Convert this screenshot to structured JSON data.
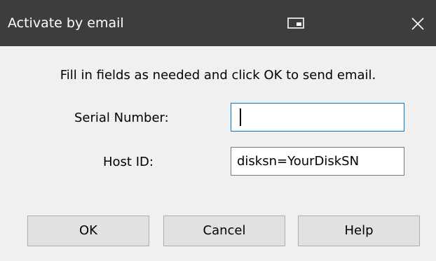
{
  "window": {
    "title": "Activate by email",
    "icons": {
      "snap": "snap-layout-icon",
      "close": "close-icon"
    },
    "colors": {
      "titlebar": "#3d3d3d",
      "body": "#f0f0f0",
      "focus_border": "#0078d7"
    }
  },
  "form": {
    "instructions": "Fill in fields as needed and click OK to send email.",
    "serial_label": "Serial Number:",
    "serial_value": "",
    "host_label": "Host ID:",
    "host_value": "disksn=YourDiskSN"
  },
  "buttons": {
    "ok": "OK",
    "cancel": "Cancel",
    "help": "Help"
  }
}
